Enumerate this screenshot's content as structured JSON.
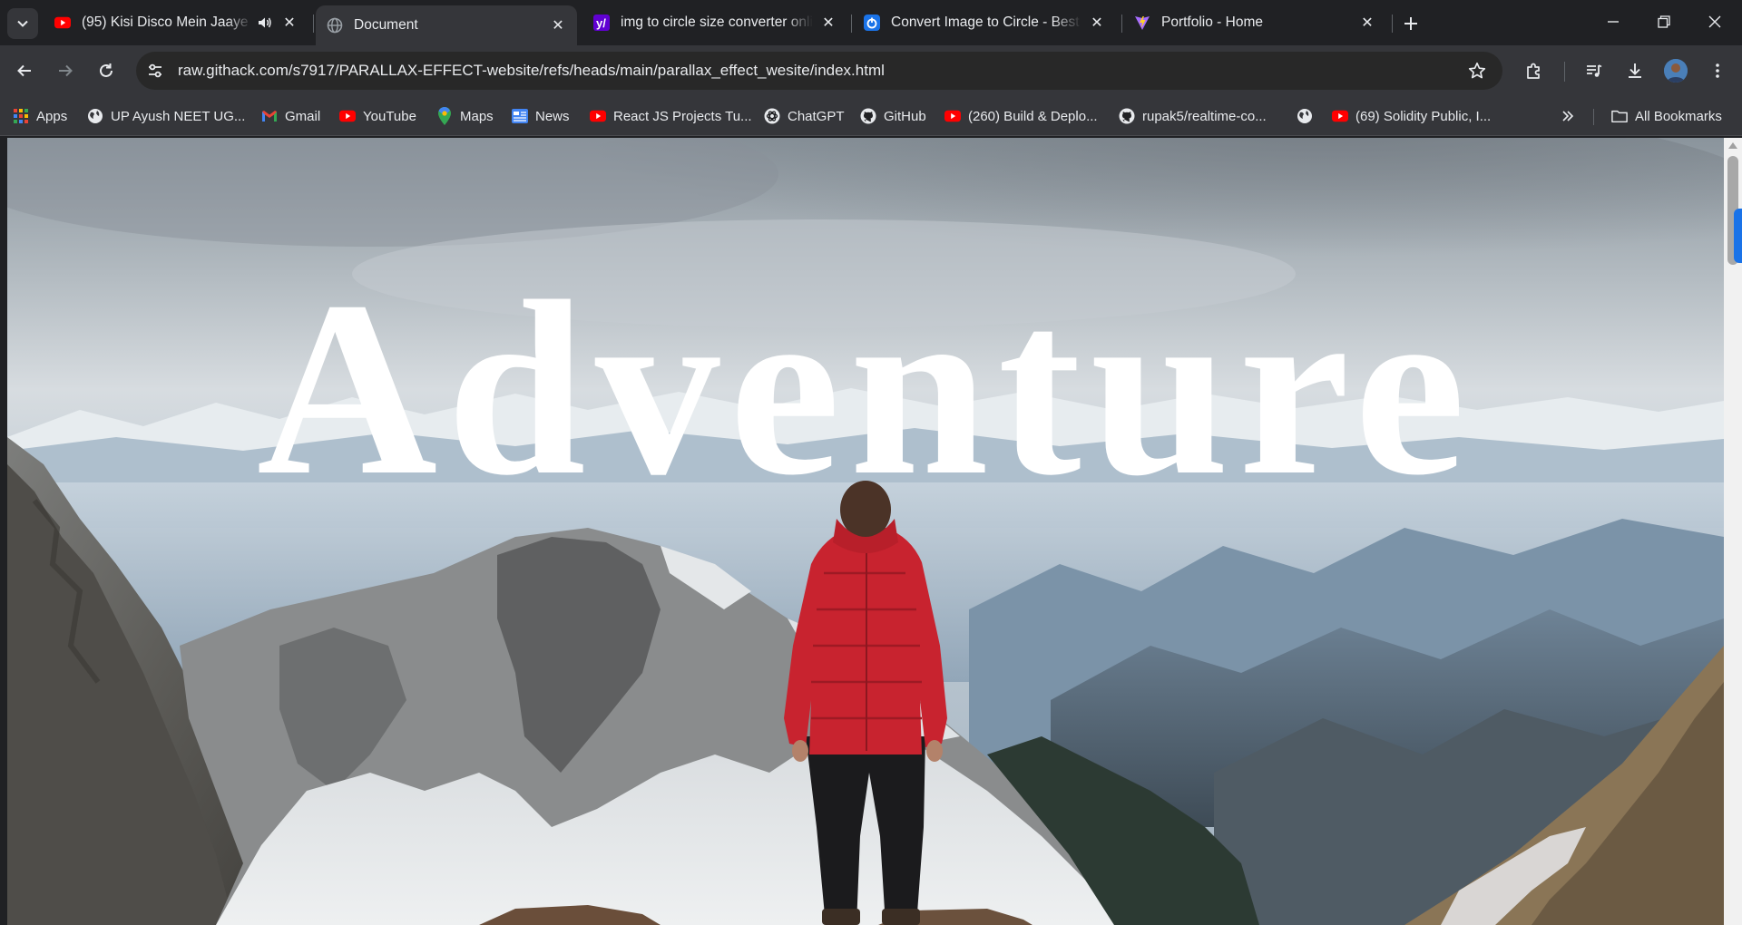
{
  "tabs": [
    {
      "title": "(95) Kisi Disco Mein Jaaye K",
      "favicon": "youtube-icon",
      "audio": true,
      "active": false
    },
    {
      "title": "Document",
      "favicon": "globe-icon",
      "active": true
    },
    {
      "title": "img to circle size converter onli",
      "favicon": "yahoo-icon",
      "active": false
    },
    {
      "title": "Convert Image to Circle - Best I",
      "favicon": "power-icon",
      "active": false
    },
    {
      "title": "Portfolio - Home",
      "favicon": "vite-icon",
      "active": false
    }
  ],
  "toolbar": {
    "url": "raw.githack.com/s7917/PARALLAX-EFFECT-website/refs/heads/main/parallax_effect_wesite/index.html"
  },
  "bookmarks": [
    {
      "label": "Apps",
      "icon": "apps-grid-icon"
    },
    {
      "label": "UP Ayush NEET UG...",
      "icon": "globe-icon"
    },
    {
      "label": "Gmail",
      "icon": "gmail-icon"
    },
    {
      "label": "YouTube",
      "icon": "youtube-icon"
    },
    {
      "label": "Maps",
      "icon": "maps-icon"
    },
    {
      "label": "News",
      "icon": "news-icon"
    },
    {
      "label": "React JS Projects Tu...",
      "icon": "youtube-icon"
    },
    {
      "label": "ChatGPT",
      "icon": "chatgpt-icon"
    },
    {
      "label": "GitHub",
      "icon": "github-icon"
    },
    {
      "label": "(260) Build & Deplo...",
      "icon": "youtube-icon"
    },
    {
      "label": "rupak5/realtime-co...",
      "icon": "github-icon"
    },
    {
      "label": "",
      "icon": "globe-icon"
    },
    {
      "label": "(69) Solidity Public, I...",
      "icon": "youtube-icon"
    }
  ],
  "all_bookmarks_label": "All Bookmarks",
  "page": {
    "hero_title": "Adventure"
  },
  "colors": {
    "chrome_dark": "#202124",
    "chrome_toolbar": "#35363a",
    "youtube_red": "#ff0000",
    "jacket_red": "#c8232f"
  }
}
